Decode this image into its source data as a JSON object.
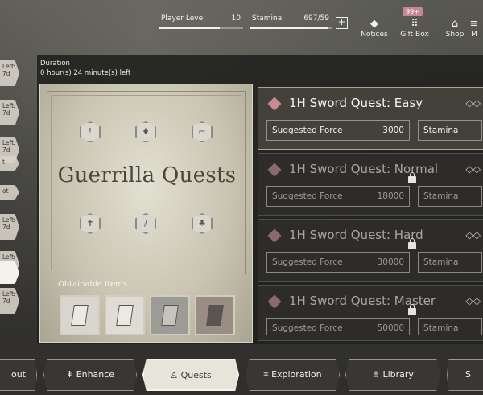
{
  "top_bar": {
    "player_level": {
      "label": "Player Level",
      "value": "10",
      "progress": 0.72
    },
    "stamina": {
      "label": "Stamina",
      "value": "697/59",
      "progress": 0.95
    },
    "nav": [
      {
        "label": "Notices",
        "icon": "notice-icon"
      },
      {
        "label": "Gift Box",
        "icon": "gift-box-icon"
      },
      {
        "label": "Shop",
        "icon": "shop-icon"
      },
      {
        "label": "M",
        "icon": "menu-icon"
      }
    ],
    "gift_badge": "99+"
  },
  "left_tabs": [
    {
      "label": "Left:\n7d"
    },
    {
      "label": "Left:\n7d"
    },
    {
      "label": "Left:\n7d"
    },
    {
      "label": "t"
    },
    {
      "label": "ot"
    },
    {
      "label": "Left:\n7d"
    },
    {
      "label": "Left:\n7d"
    },
    {
      "label": ""
    },
    {
      "label": "Left:\n7d"
    }
  ],
  "duration": {
    "label": "Duration",
    "value": "0 hour(s) 24 minute(s) left"
  },
  "event_card": {
    "title": "Guerrilla Quests",
    "obtainable_label": "Obtainable Items"
  },
  "quests": [
    {
      "title": "1H Sword Quest: Easy",
      "force_label": "Suggested Force",
      "force": "3000",
      "stamina_label": "Stamina",
      "locked": false
    },
    {
      "title": "1H Sword Quest: Normal",
      "force_label": "Suggested Force",
      "force": "18000",
      "stamina_label": "Stamina",
      "locked": true
    },
    {
      "title": "1H Sword Quest: Hard",
      "force_label": "Suggested Force",
      "force": "30000",
      "stamina_label": "Stamina",
      "locked": true
    },
    {
      "title": "1H Sword Quest: Master",
      "force_label": "Suggested Force",
      "force": "50000",
      "stamina_label": "Stamina",
      "locked": true
    }
  ],
  "bottom_nav": {
    "out": "out",
    "enhance": "Enhance",
    "quests": "Quests",
    "exploration": "Exploration",
    "library": "Library",
    "s": "S"
  }
}
